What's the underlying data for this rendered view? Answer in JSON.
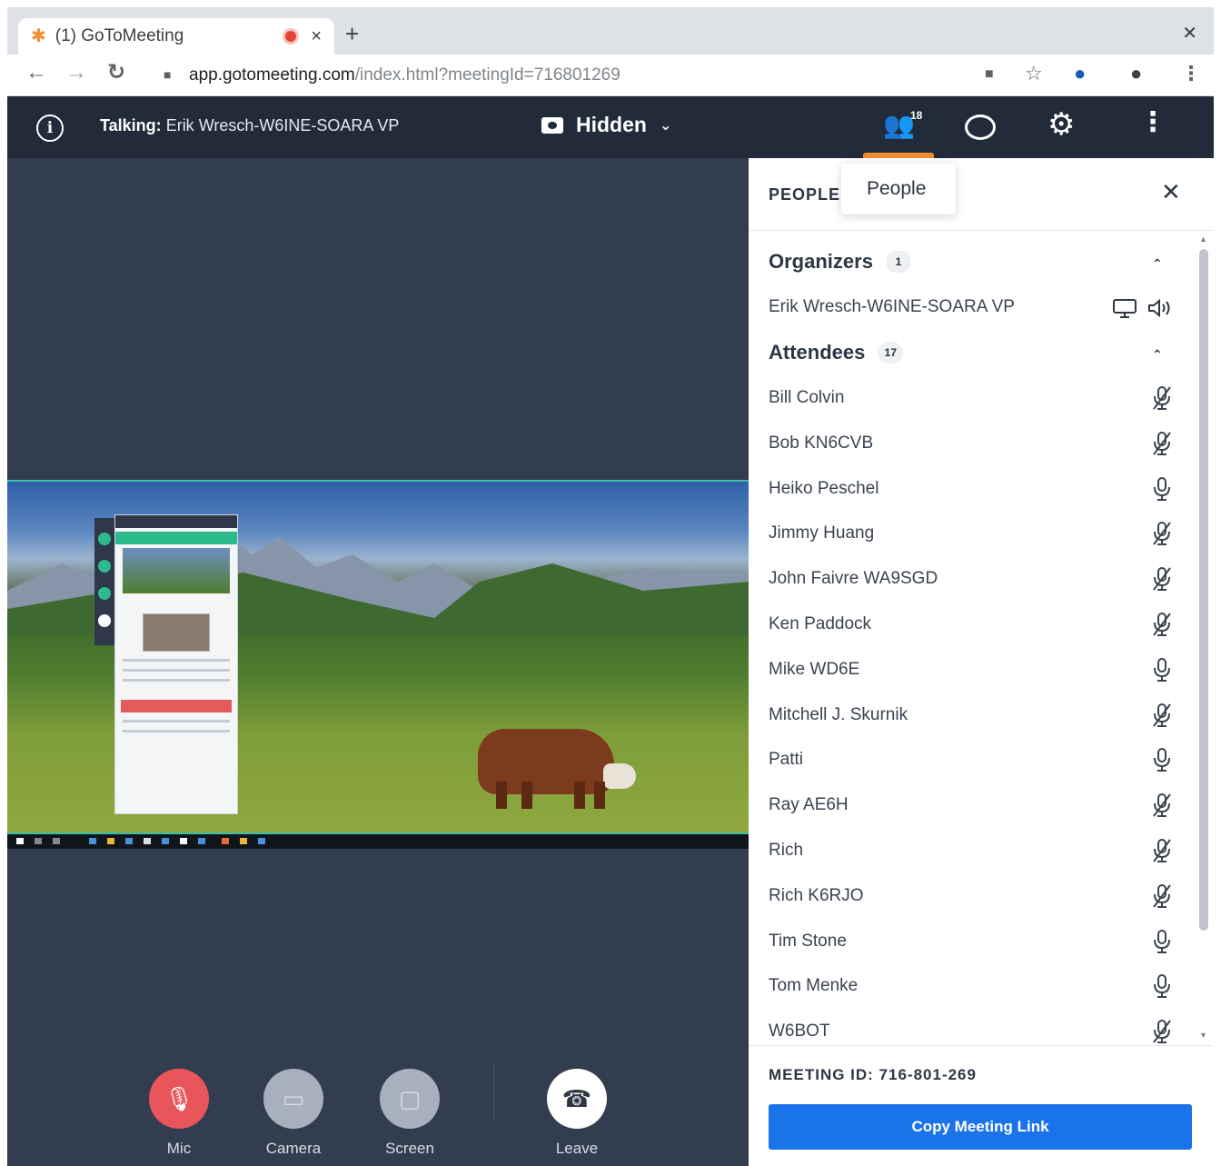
{
  "browser": {
    "tab_title": "(1) GoToMeeting",
    "url_host": "app.gotomeeting.com",
    "url_path": "/index.html?meetingId=716801269"
  },
  "topbar": {
    "talking_label": "Talking:",
    "talking_name": "Erik Wresch-W6INE-SOARA VP",
    "view_mode": "Hidden",
    "people_count": "18"
  },
  "controls": {
    "mic": "Mic",
    "camera": "Camera",
    "screen": "Screen",
    "leave": "Leave"
  },
  "panel": {
    "title": "PEOPLE",
    "tooltip": "People",
    "organizers": {
      "label": "Organizers",
      "count": "1",
      "members": [
        "Erik Wresch-W6INE-SOARA VP"
      ]
    },
    "attendees": {
      "label": "Attendees",
      "count": "17",
      "members": [
        {
          "name": "Bill Colvin",
          "muted": true
        },
        {
          "name": "Bob KN6CVB",
          "muted": true
        },
        {
          "name": "Heiko Peschel",
          "muted": false
        },
        {
          "name": "Jimmy Huang",
          "muted": true
        },
        {
          "name": "John Faivre WA9SGD",
          "muted": true
        },
        {
          "name": "Ken Paddock",
          "muted": true
        },
        {
          "name": "Mike WD6E",
          "muted": false
        },
        {
          "name": "Mitchell J. Skurnik",
          "muted": true
        },
        {
          "name": "Patti",
          "muted": false
        },
        {
          "name": "Ray AE6H",
          "muted": true
        },
        {
          "name": "Rich",
          "muted": true
        },
        {
          "name": "Rich K6RJO",
          "muted": true
        },
        {
          "name": "Tim Stone",
          "muted": false
        },
        {
          "name": "Tom Menke",
          "muted": false
        },
        {
          "name": "W6BOT",
          "muted": true
        }
      ]
    },
    "meeting_id": "MEETING ID: 716-801-269",
    "copy_link": "Copy Meeting Link"
  },
  "colors": {
    "app_bg": "#323d4f",
    "topbar_bg": "#212b3a",
    "accent_orange": "#f68d2e",
    "mic_muted_red": "#e8555a",
    "copy_button_blue": "#1a73e8"
  }
}
